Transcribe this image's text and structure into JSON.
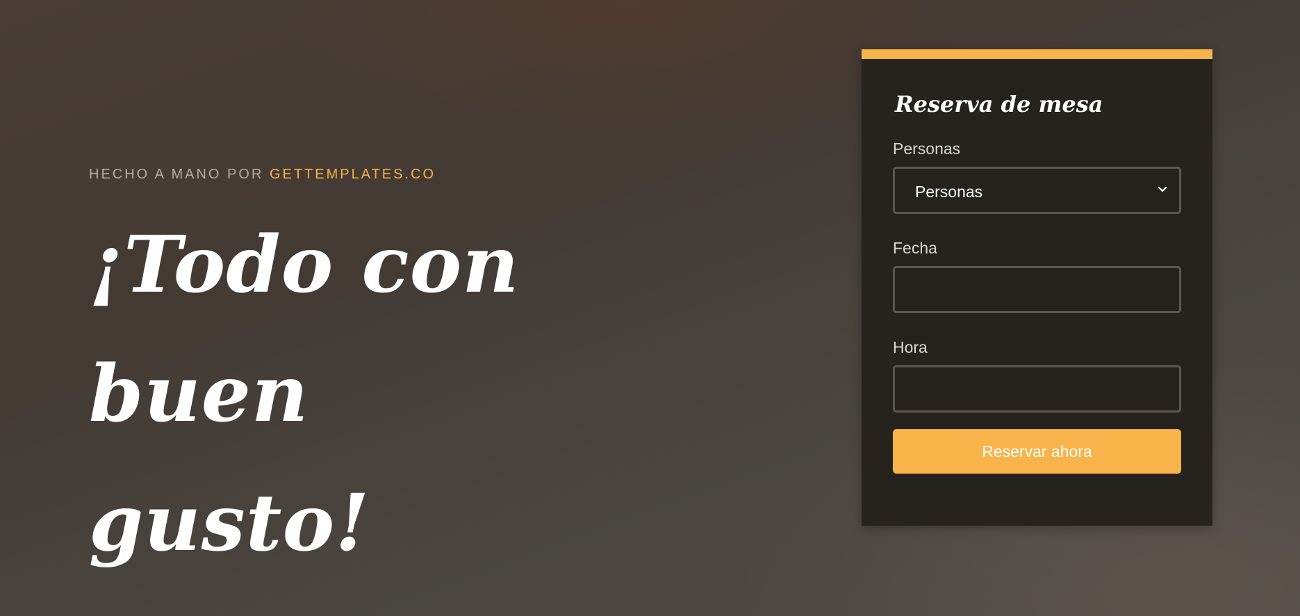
{
  "hero": {
    "credit_prefix": "HECHO A MANO POR ",
    "credit_brand": "GETTEMPLATES.CO",
    "headline_line1": "¡Todo con buen",
    "headline_line2": "gusto!"
  },
  "reservation": {
    "title": "Reserva de mesa",
    "people_label": "Personas",
    "people_selected": "Personas",
    "date_label": "Fecha",
    "date_value": "",
    "time_label": "Hora",
    "time_value": "",
    "submit_label": "Reservar ahora"
  },
  "colors": {
    "accent": "#f8b44a",
    "card_background": "#26231f"
  },
  "icons": {
    "select_arrow": "chevron-down-icon"
  }
}
